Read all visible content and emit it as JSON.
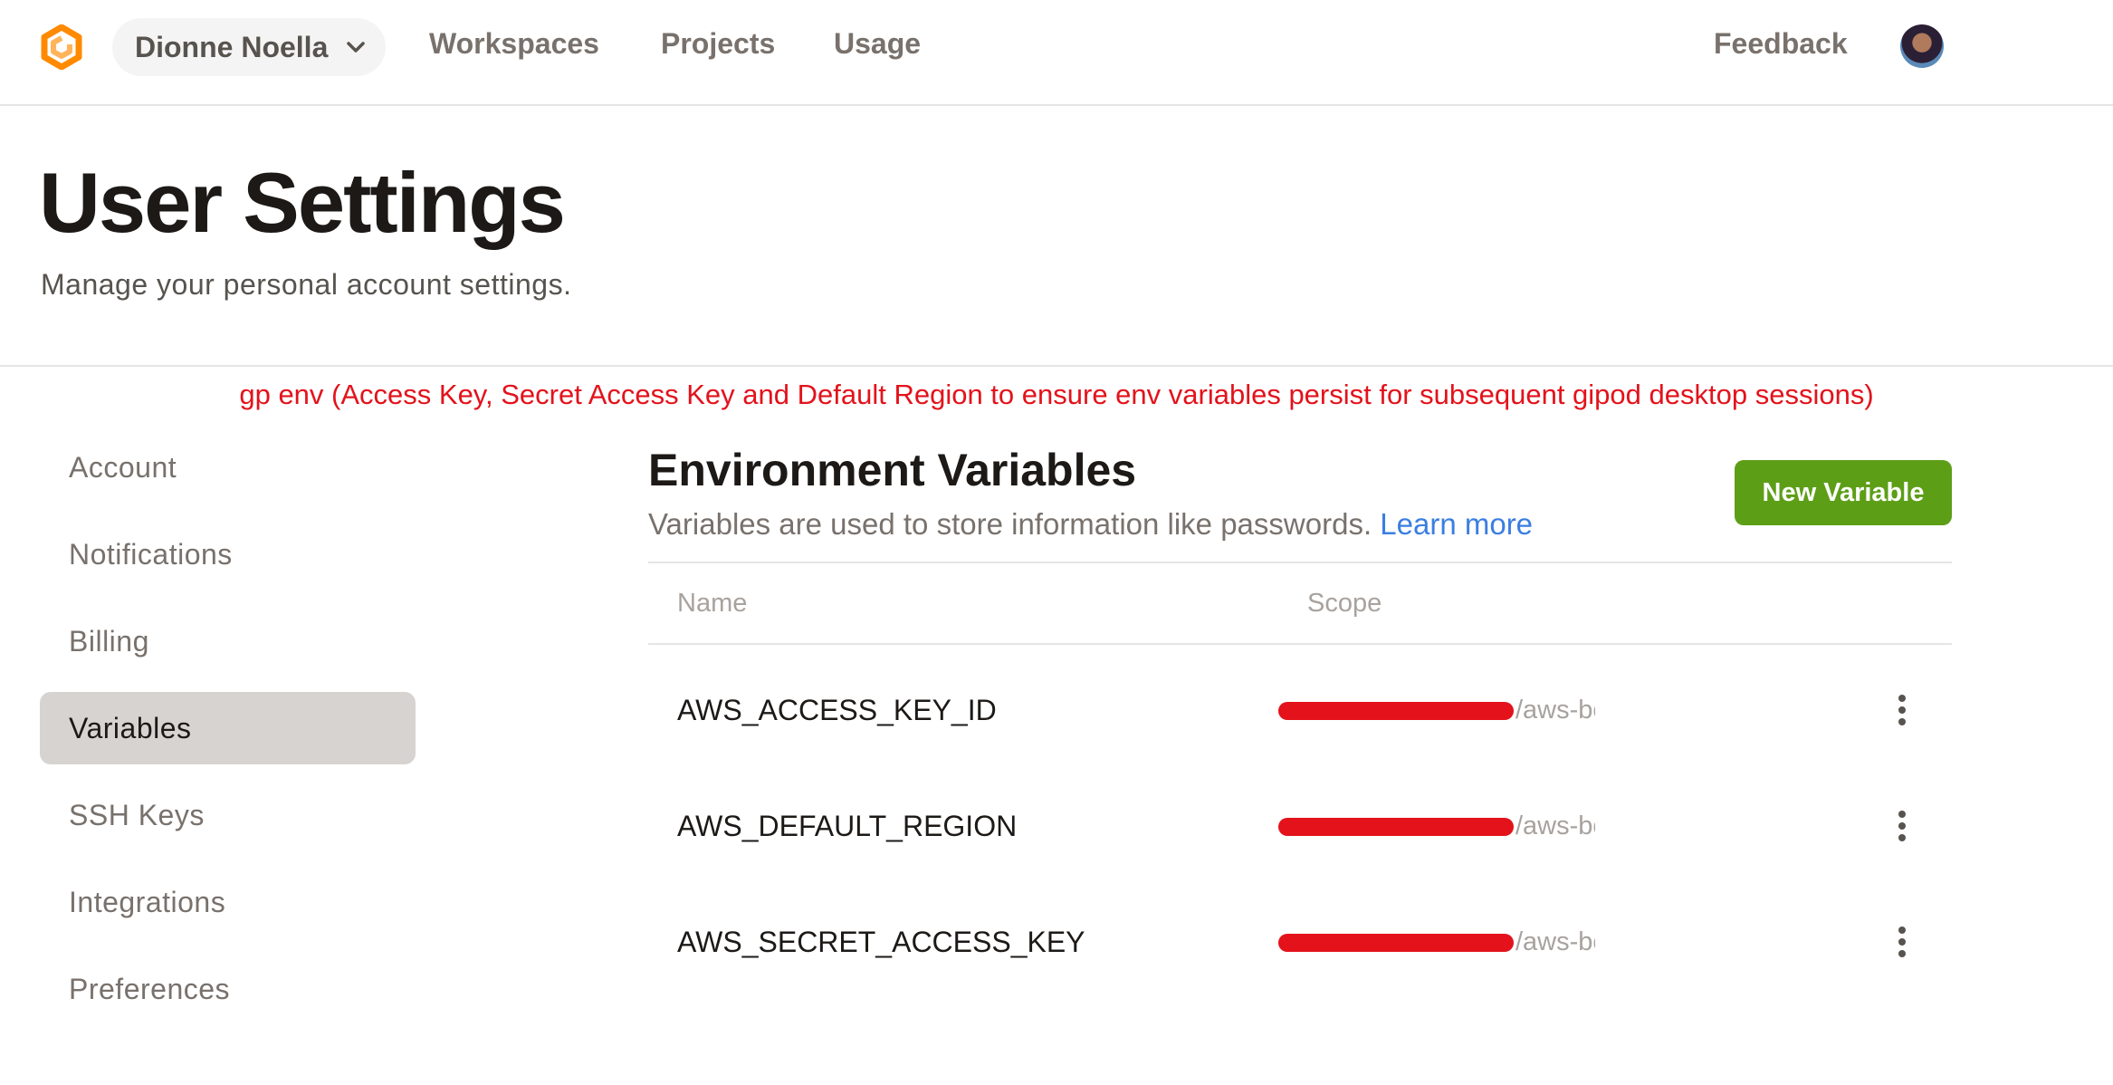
{
  "nav": {
    "org_name": "Dionne Noella",
    "links": [
      "Workspaces",
      "Projects",
      "Usage"
    ],
    "feedback": "Feedback"
  },
  "header": {
    "title": "User Settings",
    "subtitle": "Manage your personal account settings."
  },
  "annotation": "gp env (Access Key, Secret Access Key and Default Region to ensure env variables persist for subsequent gipod desktop sessions)",
  "sidebar": {
    "items": [
      "Account",
      "Notifications",
      "Billing",
      "Variables",
      "SSH Keys",
      "Integrations",
      "Preferences"
    ],
    "active": "Variables"
  },
  "env": {
    "title": "Environment Variables",
    "description": "Variables are used to store information like passwords.",
    "learn_more": "Learn more",
    "new_button": "New Variable",
    "columns": [
      "Name",
      "Scope"
    ],
    "rows": [
      {
        "name": "AWS_ACCESS_KEY_ID",
        "scope": "/aws-bootcamp-cruddur-..."
      },
      {
        "name": "AWS_DEFAULT_REGION",
        "scope": "/aws-bootcamp-cruddur-..."
      },
      {
        "name": "AWS_SECRET_ACCESS_KEY",
        "scope": "/aws-bootcamp-cruddur-..."
      }
    ]
  },
  "colors": {
    "accent_green": "#5d9e17",
    "link_blue": "#3b7ee1",
    "annotation_red": "#e3121b",
    "logo_orange": "#ff8a00"
  },
  "icons": [
    "gitpod-logo-icon",
    "chevron-down-icon",
    "avatar",
    "more-vertical-icon"
  ]
}
